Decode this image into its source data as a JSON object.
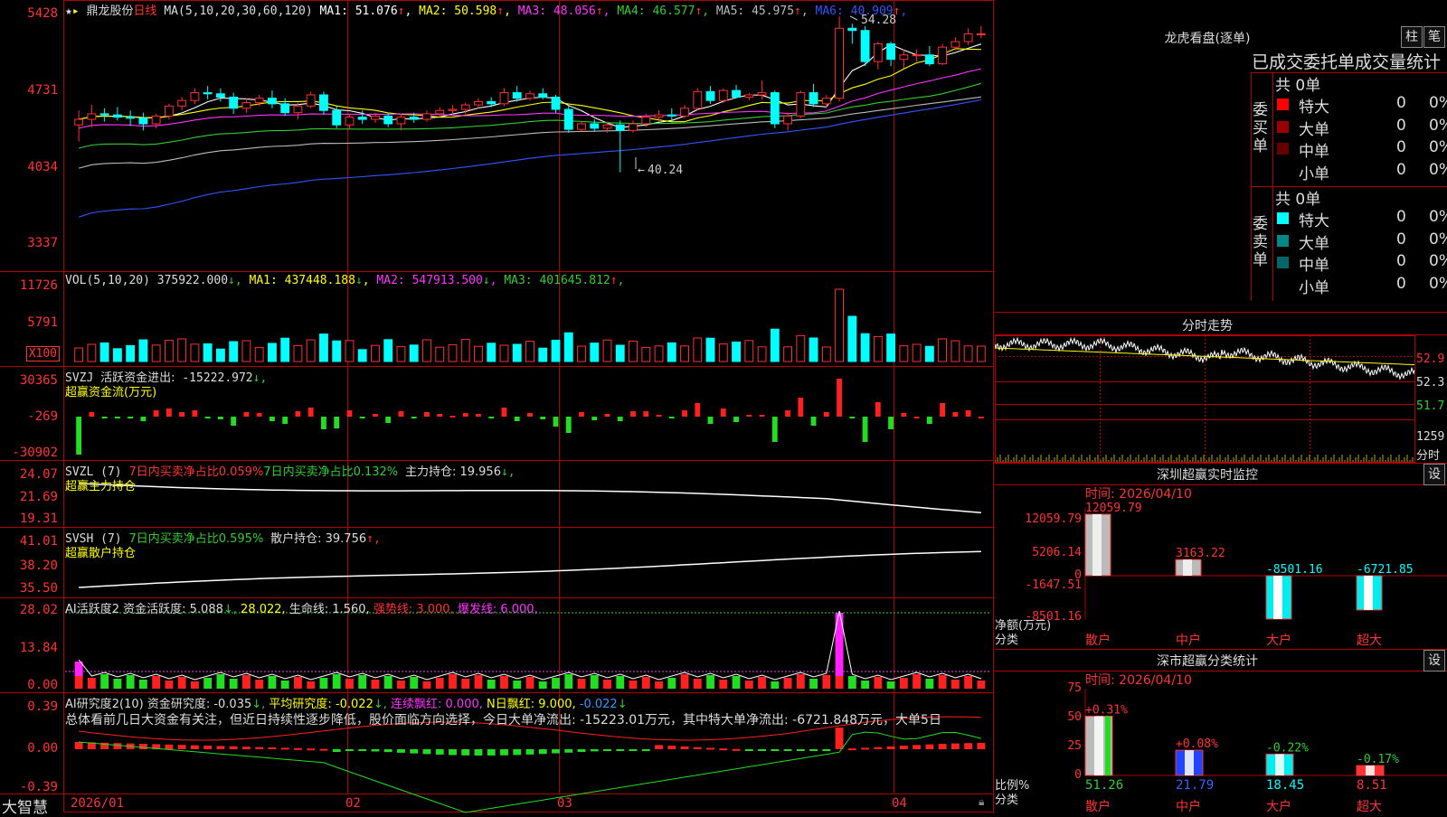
{
  "stock": {
    "name": "鼎龙股份",
    "period": "日线",
    "ma_def": "MA(5,10,20,30,60,120)",
    "ma": [
      {
        "label": "MA1:",
        "value": "51.076",
        "color": "#ffffff"
      },
      {
        "label": "MA2:",
        "value": "50.598",
        "color": "#ffff00"
      },
      {
        "label": "MA3:",
        "value": "48.056",
        "color": "#ff33ff"
      },
      {
        "label": "MA4:",
        "value": "46.577",
        "color": "#33cc33"
      },
      {
        "label": "MA5:",
        "value": "45.975",
        "color": "#bbbbbb"
      },
      {
        "label": "MA6:",
        "value": "40.909",
        "color": "#3355ff"
      }
    ],
    "y_ticks": [
      "5428",
      "4731",
      "4034",
      "3337"
    ],
    "high_label": "54.28",
    "low_label": "40.24"
  },
  "vol": {
    "def": "VOL(5,10,20)",
    "value": "375922.000",
    "ma": [
      {
        "label": "MA1:",
        "value": "437448.188",
        "color": "#ffff00"
      },
      {
        "label": "MA2:",
        "value": "547913.500",
        "color": "#ff33ff"
      },
      {
        "label": "MA3:",
        "value": "401645.812",
        "color": "#33cc33"
      }
    ],
    "y_ticks": [
      "11726",
      "5791"
    ],
    "unit": "X100"
  },
  "svzj": {
    "def": "SVZJ",
    "label": "活跃资金进出:",
    "value": "-15222.972",
    "subtitle": "超赢资金流(万元)",
    "y_ticks": [
      "30365",
      "-269",
      "-30902"
    ]
  },
  "svzl": {
    "def": "SVZL (7)",
    "t1": "7日内买卖净占比0.059%",
    "t2": "7日内买卖净占比0.132%",
    "t3": "主力持仓: 19.956",
    "subtitle": "超赢主力持仓",
    "y_ticks": [
      "24.07",
      "21.69",
      "19.31"
    ]
  },
  "svsh": {
    "def": "SVSH (7)",
    "t1": "7日内买卖净占比0.595%",
    "t2": "散户持仓: 39.756",
    "subtitle": "超赢散户持仓",
    "y_ticks": [
      "41.01",
      "38.20",
      "35.50"
    ]
  },
  "ai1": {
    "def": "AI活跃度2",
    "t1": "资金活跃度: 5.088",
    "t2": "28.022,",
    "t3": "生命线: 1.560,",
    "t4": "强势线: 3.000,",
    "t5": "爆发线: 6.000,",
    "y_ticks": [
      "28.02",
      "13.84",
      "0.00"
    ]
  },
  "ai2": {
    "def": "AI研究度2(10)",
    "t1": "资金研究度: -0.035",
    "t2": "平均研究度: -0.022",
    "t3": "连续飘红: 0.000",
    "t4": "N日飘红: 9.000,",
    "t5": "-0.022",
    "comment": "总体看前几日大资金有关注，但近日持续性逐步降低，股价面临方向选择，今日大单净流出: -15223.01万元，其中特大单净流出: -6721.848万元，大单5日",
    "y_ticks": [
      "0.39",
      "0.00",
      "-0.39"
    ]
  },
  "bottom": {
    "logo": "大智慧",
    "dates": [
      "2026/01",
      "02",
      "03",
      "04"
    ]
  },
  "dragon": {
    "title": "龙虎看盘(逐单)",
    "btn1": "柱",
    "btn2": "笔",
    "header": "已成交委托单成交量统计",
    "buy_label": "委买单",
    "sell_label": "委卖单",
    "buy_total": "共 0单",
    "sell_total": "共 0单",
    "buy_rows": [
      {
        "name": "特大",
        "count": "0",
        "pct": "0%",
        "color": "#ff0000"
      },
      {
        "name": "大单",
        "count": "0",
        "pct": "0%",
        "color": "#990000"
      },
      {
        "name": "中单",
        "count": "0",
        "pct": "0%",
        "color": "#660000"
      },
      {
        "name": "小单",
        "count": "0",
        "pct": "0%",
        "color": "#000000"
      }
    ],
    "sell_rows": [
      {
        "name": "特大",
        "count": "0",
        "pct": "0%",
        "color": "#00ffff"
      },
      {
        "name": "大单",
        "count": "0",
        "pct": "0%",
        "color": "#008888"
      },
      {
        "name": "中单",
        "count": "0",
        "pct": "0%",
        "color": "#006666"
      },
      {
        "name": "小单",
        "count": "0",
        "pct": "0%",
        "color": "#000000"
      }
    ]
  },
  "intraday": {
    "title": "分时走势",
    "y_ticks": [
      "52.9",
      "52.3",
      "51.7"
    ],
    "vol_tick": "1259",
    "vol_unit": "分时"
  },
  "sz_monitor": {
    "title": "深圳超赢实时监控",
    "btn": "设",
    "time": "时间: 2026/04/10",
    "y_ticks": [
      "12059.79",
      "5206.14",
      "0",
      "-1647.51",
      "-8501.16"
    ],
    "ylabel": "净额(万元)",
    "xlabel": "分类",
    "categories": [
      "散户",
      "中户",
      "大户",
      "超大"
    ],
    "values": [
      "12059.79",
      "3163.22",
      "-8501.16",
      "-6721.85"
    ]
  },
  "sz_class": {
    "title": "深市超赢分类统计",
    "btn": "设",
    "time": "时间: 2026/04/10",
    "y_ticks": [
      "75",
      "50",
      "25",
      "0"
    ],
    "ylabel": "比例%",
    "xlabel": "分类",
    "categories": [
      "散户",
      "中户",
      "大户",
      "超大"
    ],
    "values": [
      "51.26",
      "21.79",
      "18.45",
      "8.51"
    ],
    "changes": [
      "+0.31%",
      "+0.08%",
      "-0.22%",
      "-0.17%"
    ]
  },
  "chart_data": [
    {
      "type": "candlestick",
      "title": "鼎龙股份 日线",
      "ylim": [
        33.37,
        54.28
      ],
      "ohlc": [
        [
          44.5,
          45.8,
          43.0,
          45.0
        ],
        [
          45.0,
          46.3,
          44.3,
          45.5
        ],
        [
          45.5,
          46.0,
          44.8,
          45.4
        ],
        [
          45.4,
          46.1,
          44.9,
          45.2
        ],
        [
          45.2,
          45.8,
          44.4,
          45.1
        ],
        [
          45.1,
          45.6,
          44.0,
          44.6
        ],
        [
          44.6,
          45.5,
          44.2,
          45.3
        ],
        [
          45.3,
          46.4,
          45.0,
          46.2
        ],
        [
          46.2,
          47.0,
          45.8,
          46.7
        ],
        [
          46.7,
          47.8,
          46.4,
          47.4
        ],
        [
          47.4,
          48.0,
          46.8,
          47.3
        ],
        [
          47.3,
          47.8,
          46.6,
          47.0
        ],
        [
          47.0,
          47.4,
          45.5,
          46.0
        ],
        [
          46.0,
          46.9,
          45.6,
          46.5
        ],
        [
          46.5,
          47.2,
          46.2,
          46.9
        ],
        [
          46.9,
          47.6,
          46.0,
          46.4
        ],
        [
          46.4,
          46.9,
          45.3,
          45.6
        ],
        [
          45.6,
          46.5,
          45.0,
          46.2
        ],
        [
          46.2,
          47.5,
          46.0,
          47.2
        ],
        [
          47.2,
          47.5,
          45.4,
          45.8
        ],
        [
          45.8,
          46.2,
          44.2,
          44.5
        ],
        [
          44.5,
          45.5,
          44.1,
          45.2
        ],
        [
          45.2,
          45.8,
          44.6,
          45.0
        ],
        [
          45.0,
          45.6,
          44.7,
          45.3
        ],
        [
          45.3,
          45.6,
          44.3,
          44.6
        ],
        [
          44.6,
          45.5,
          44.0,
          45.2
        ],
        [
          45.2,
          45.6,
          44.7,
          45.0
        ],
        [
          45.0,
          45.8,
          44.8,
          45.5
        ],
        [
          45.5,
          46.1,
          45.2,
          45.8
        ],
        [
          45.8,
          46.3,
          45.4,
          45.9
        ],
        [
          45.9,
          46.5,
          45.5,
          46.3
        ],
        [
          46.3,
          46.9,
          46.0,
          46.6
        ],
        [
          46.6,
          47.0,
          46.1,
          46.4
        ],
        [
          46.4,
          47.8,
          46.2,
          47.4
        ],
        [
          47.4,
          48.0,
          46.6,
          46.9
        ],
        [
          46.9,
          47.6,
          46.7,
          47.3
        ],
        [
          47.3,
          47.8,
          46.8,
          47.0
        ],
        [
          47.0,
          47.2,
          45.6,
          45.9
        ],
        [
          45.9,
          46.2,
          43.8,
          44.1
        ],
        [
          44.1,
          44.8,
          43.9,
          44.6
        ],
        [
          44.6,
          45.0,
          43.9,
          44.2
        ],
        [
          44.2,
          44.8,
          43.8,
          44.5
        ],
        [
          44.5,
          44.9,
          40.24,
          44.0
        ],
        [
          44.0,
          44.9,
          43.8,
          44.6
        ],
        [
          44.6,
          45.5,
          44.3,
          45.2
        ],
        [
          45.2,
          45.8,
          44.8,
          45.4
        ],
        [
          45.4,
          46.0,
          44.9,
          45.3
        ],
        [
          45.3,
          46.3,
          45.1,
          46.0
        ],
        [
          46.0,
          47.8,
          45.8,
          47.5
        ],
        [
          47.5,
          48.0,
          46.4,
          46.7
        ],
        [
          46.7,
          47.8,
          46.5,
          47.6
        ],
        [
          47.6,
          48.1,
          46.9,
          47.0
        ],
        [
          47.0,
          47.4,
          46.7,
          47.2
        ],
        [
          47.2,
          48.5,
          46.8,
          47.4
        ],
        [
          47.4,
          47.6,
          44.2,
          44.6
        ],
        [
          44.6,
          45.6,
          44.0,
          45.3
        ],
        [
          45.3,
          47.6,
          45.1,
          47.4
        ],
        [
          47.4,
          48.2,
          46.1,
          46.4
        ],
        [
          46.4,
          47.2,
          46.0,
          46.9
        ],
        [
          46.9,
          54.28,
          46.6,
          53.2
        ],
        [
          53.2,
          53.6,
          51.8,
          53.0
        ],
        [
          53.0,
          53.4,
          49.8,
          50.2
        ],
        [
          50.2,
          52.0,
          49.5,
          51.8
        ],
        [
          51.8,
          52.0,
          49.8,
          50.4
        ],
        [
          50.4,
          51.3,
          49.6,
          50.8
        ],
        [
          50.8,
          51.3,
          50.2,
          50.8
        ],
        [
          50.8,
          51.6,
          49.8,
          50.0
        ],
        [
          50.0,
          51.8,
          49.9,
          51.5
        ],
        [
          51.5,
          52.4,
          51.2,
          52.0
        ],
        [
          52.0,
          53.2,
          51.7,
          52.7
        ],
        [
          52.7,
          53.4,
          52.3,
          52.7
        ]
      ],
      "high_annotation": 54.28,
      "low_annotation": 40.24
    },
    {
      "type": "bar",
      "title": "VOL(5,10,20)",
      "ylim": [
        0,
        11726
      ],
      "unit": "X100",
      "latest": 375922
    }
  ]
}
